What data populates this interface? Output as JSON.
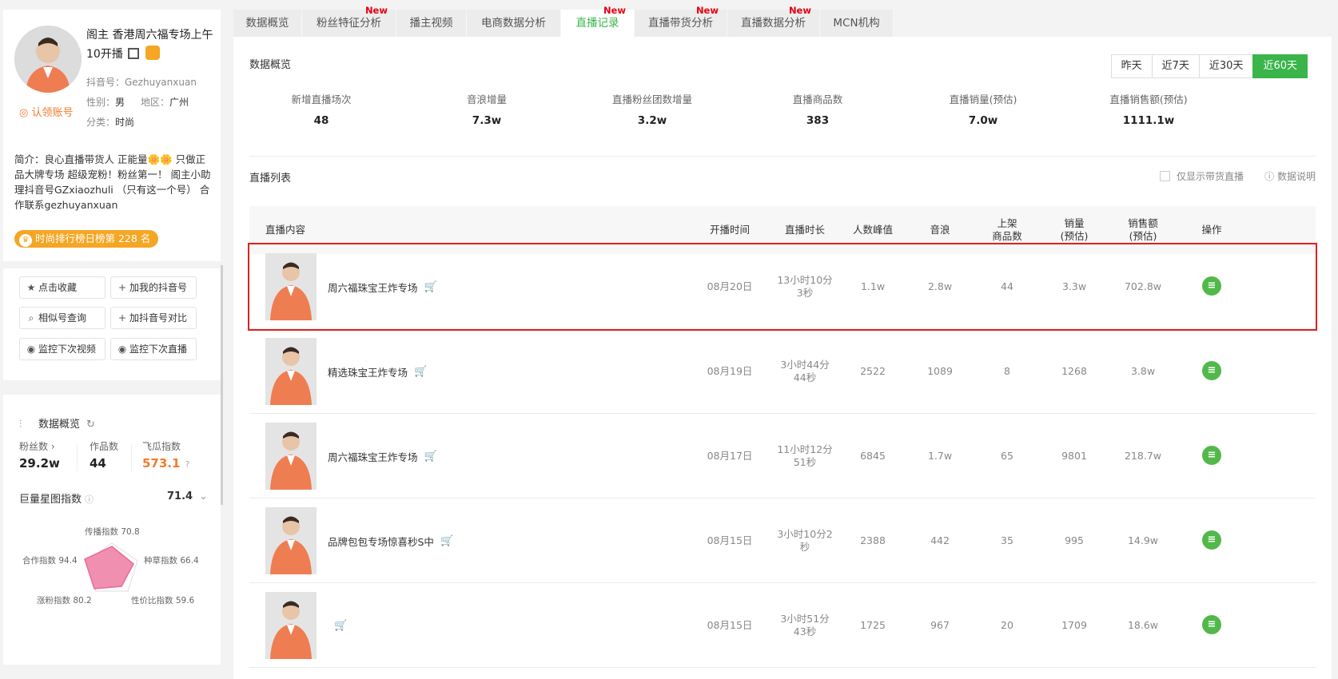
{
  "profile": {
    "name": "阁主 香港周六福专场上午10开播",
    "douyin_id": "抖音号：Gezhuyanxuan",
    "gender_label": "性别：",
    "gender": "男",
    "region_label": "地区：",
    "region": "广州",
    "category_label": "分类：",
    "category": "时尚",
    "claim_label": "认领账号",
    "intro": "简介：良心直播带货人 正能量🌼🌼 只做正品大牌专场 超级宠粉！粉丝第一！ 阁主小助理抖音号GZxiaozhuli （只有这一个号） 合作联系gezhuyanxuan",
    "rank": "时尚排行榜日榜第 228 名"
  },
  "actions": {
    "favorite": "点击收藏",
    "add_mine": "加我的抖音号",
    "similar": "相似号查询",
    "compare": "加抖音号对比",
    "monitor_video": "监控下次视频",
    "monitor_live": "监控下次直播"
  },
  "overview": {
    "title": "数据概览",
    "fans_label": "粉丝数 ›",
    "fans": "29.2w",
    "works_label": "作品数",
    "works": "44",
    "index_label": "飞瓜指数",
    "index": "573.1",
    "jl_label": "巨量星图指数",
    "jl_value": "71.4",
    "radar": {
      "spread": "传播指数 70.8",
      "seed": "种草指数 66.4",
      "value": "性价比指数 59.6",
      "fans_growth": "涨粉指数 80.2",
      "coop": "合作指数 94.4"
    }
  },
  "tabs": [
    {
      "label": "数据概览",
      "new": ""
    },
    {
      "label": "粉丝特征分析",
      "new": "New"
    },
    {
      "label": "播主视频",
      "new": ""
    },
    {
      "label": "电商数据分析",
      "new": ""
    },
    {
      "label": "直播记录",
      "new": "New"
    },
    {
      "label": "直播带货分析",
      "new": "New"
    },
    {
      "label": "直播数据分析",
      "new": "New"
    },
    {
      "label": "MCN机构",
      "new": ""
    }
  ],
  "main": {
    "overview_title": "数据概览",
    "ranges": [
      "昨天",
      "近7天",
      "近30天",
      "近60天"
    ],
    "kpis": [
      {
        "label": "新增直播场次",
        "value": "48"
      },
      {
        "label": "音浪增量",
        "value": "7.3w"
      },
      {
        "label": "直播粉丝团数增量",
        "value": "3.2w"
      },
      {
        "label": "直播商品数",
        "value": "383"
      },
      {
        "label": "直播销量(预估)",
        "value": "7.0w"
      },
      {
        "label": "直播销售额(预估)",
        "value": "1111.1w"
      }
    ],
    "list_title": "直播列表",
    "only_goods": "仅显示带货直播",
    "data_note": "数据说明"
  },
  "table": {
    "headers": {
      "content": "直播内容",
      "start": "开播时间",
      "duration": "直播时长",
      "peak": "人数峰值",
      "yinlang": "音浪",
      "goods_1": "上架",
      "goods_2": "商品数",
      "sales_1": "销量",
      "sales_2": "(预估)",
      "revenue_1": "销售额",
      "revenue_2": "(预估)",
      "op": "操作"
    },
    "rows": [
      {
        "title": "周六福珠宝王炸专场",
        "start": "08月20日",
        "dur1": "13小时10分",
        "dur2": "3秒",
        "peak": "1.1w",
        "yinlang": "2.8w",
        "goods": "44",
        "sales": "3.3w",
        "revenue": "702.8w"
      },
      {
        "title": "精选珠宝王炸专场",
        "start": "08月19日",
        "dur1": "3小时44分",
        "dur2": "44秒",
        "peak": "2522",
        "yinlang": "1089",
        "goods": "8",
        "sales": "1268",
        "revenue": "3.8w"
      },
      {
        "title": "周六福珠宝王炸专场",
        "start": "08月17日",
        "dur1": "11小时12分",
        "dur2": "51秒",
        "peak": "6845",
        "yinlang": "1.7w",
        "goods": "65",
        "sales": "9801",
        "revenue": "218.7w"
      },
      {
        "title": "品牌包包专场惊喜秒S中",
        "start": "08月15日",
        "dur1": "3小时10分2",
        "dur2": "秒",
        "peak": "2388",
        "yinlang": "442",
        "goods": "35",
        "sales": "995",
        "revenue": "14.9w"
      },
      {
        "title": "",
        "start": "08月15日",
        "dur1": "3小时51分",
        "dur2": "43秒",
        "peak": "1725",
        "yinlang": "967",
        "goods": "20",
        "sales": "1709",
        "revenue": "18.6w"
      }
    ]
  },
  "colors": {
    "accent": "#39b54a",
    "orange": "#f07c2b",
    "new": "#e60012",
    "highlight": "#e02020"
  }
}
